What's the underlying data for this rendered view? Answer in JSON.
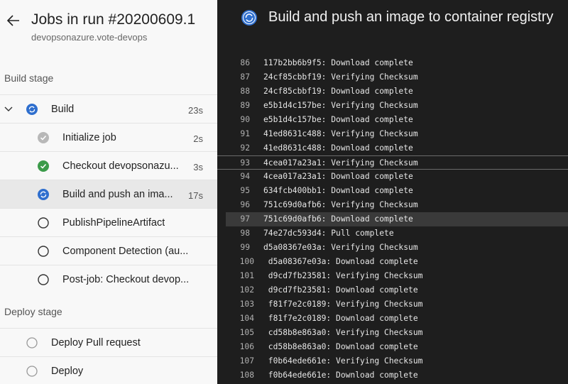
{
  "header": {
    "title": "Jobs in run #20200609.1",
    "subtitle": "devopsonazure.vote-devops"
  },
  "build_stage": {
    "label": "Build stage",
    "job": {
      "name": "Build",
      "duration": "23s"
    },
    "steps": [
      {
        "name": "Initialize job",
        "duration": "2s",
        "status": "skipped"
      },
      {
        "name": "Checkout devopsonazu...",
        "duration": "3s",
        "status": "succeeded"
      },
      {
        "name": "Build and push an ima...",
        "duration": "17s",
        "status": "running"
      },
      {
        "name": "PublishPipelineArtifact",
        "duration": "",
        "status": "pending"
      },
      {
        "name": "Component Detection (au...",
        "duration": "",
        "status": "pending"
      },
      {
        "name": "Post-job: Checkout devop...",
        "duration": "",
        "status": "pending"
      }
    ]
  },
  "deploy_stage": {
    "label": "Deploy stage",
    "jobs": [
      {
        "name": "Deploy Pull request",
        "status": "pending"
      },
      {
        "name": "Deploy",
        "status": "pending"
      }
    ]
  },
  "log": {
    "title": "Build and push an image to container registry",
    "lines": [
      {
        "n": "86",
        "text": "117b2bb6b9f5: Download complete"
      },
      {
        "n": "87",
        "text": "24cf85cbbf19: Verifying Checksum"
      },
      {
        "n": "88",
        "text": "24cf85cbbf19: Download complete"
      },
      {
        "n": "89",
        "text": "e5b1d4c157be: Verifying Checksum"
      },
      {
        "n": "90",
        "text": "e5b1d4c157be: Download complete"
      },
      {
        "n": "91",
        "text": "41ed8631c488: Verifying Checksum"
      },
      {
        "n": "92",
        "text": "41ed8631c488: Download complete"
      },
      {
        "n": "93",
        "text": "4cea017a23a1: Verifying Checksum"
      },
      {
        "n": "94",
        "text": "4cea017a23a1: Download complete"
      },
      {
        "n": "95",
        "text": "634fcb400bb1: Download complete"
      },
      {
        "n": "96",
        "text": "751c69d0afb6: Verifying Checksum"
      },
      {
        "n": "97",
        "text": "751c69d0afb6: Download complete"
      },
      {
        "n": "98",
        "text": "74e27dc593d4: Pull complete"
      },
      {
        "n": "99",
        "text": "d5a08367e03a: Verifying Checksum"
      },
      {
        "n": "100",
        "text": " d5a08367e03a: Download complete"
      },
      {
        "n": "101",
        "text": " d9cd7fb23581: Verifying Checksum"
      },
      {
        "n": "102",
        "text": " d9cd7fb23581: Download complete"
      },
      {
        "n": "103",
        "text": " f81f7e2c0189: Verifying Checksum"
      },
      {
        "n": "104",
        "text": " f81f7e2c0189: Download complete"
      },
      {
        "n": "105",
        "text": " cd58b8e863a0: Verifying Checksum"
      },
      {
        "n": "106",
        "text": " cd58b8e863a0: Download complete"
      },
      {
        "n": "107",
        "text": " f0b64ede661e: Verifying Checksum"
      },
      {
        "n": "108",
        "text": " f0b64ede661e: Download complete"
      }
    ]
  },
  "colors": {
    "running": "#2f6fce",
    "succeeded": "#3c9b4a",
    "skipped": "#b8b8b8",
    "pending": "#333333"
  }
}
